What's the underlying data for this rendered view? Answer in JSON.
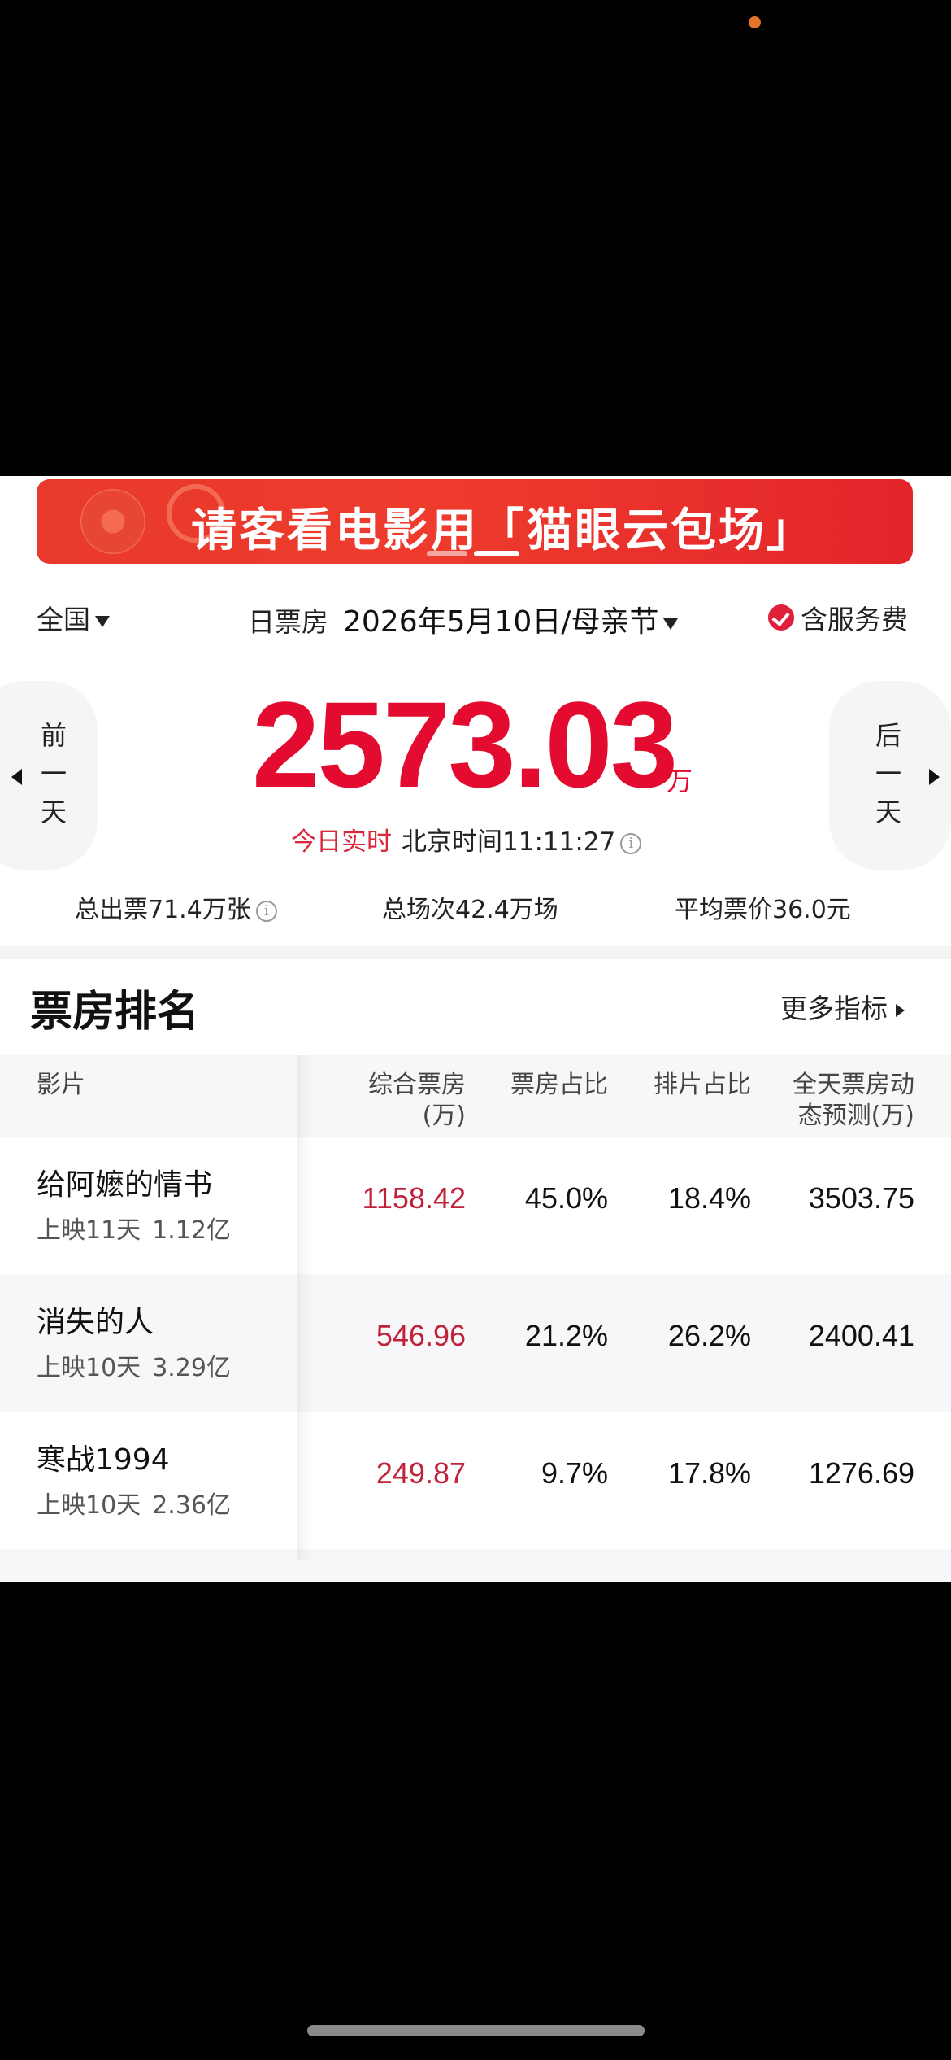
{
  "banner": {
    "text": "请客看电影用「猫眼云包场」"
  },
  "filter": {
    "region": "全国",
    "day_label": "日票房",
    "date": "2026年5月10日/母亲节",
    "service_fee": "含服务费"
  },
  "summary": {
    "prev_day": [
      "前",
      "一",
      "天"
    ],
    "next_day": [
      "后",
      "一",
      "天"
    ],
    "box_office": "2573.03",
    "unit": "万",
    "realtime_tag": "今日实时",
    "clock": "北京时间11:11:27",
    "tickets": "总出票71.4万张",
    "shows": "总场次42.4万场",
    "avg_price": "平均票价36.0元"
  },
  "ranking": {
    "title": "票房排名",
    "more": "更多指标",
    "headers": {
      "film": "影片",
      "box": [
        "综合票房",
        "(万)"
      ],
      "share": "票房占比",
      "schedule": "排片占比",
      "forecast": [
        "全天票房动",
        "态预测(万)"
      ]
    },
    "rows": [
      {
        "name": "给阿嬷的情书",
        "days": "上映11天",
        "total": "1.12亿",
        "box": "1158.42",
        "share": "45.0%",
        "schedule": "18.4%",
        "forecast": "3503.75"
      },
      {
        "name": "消失的人",
        "days": "上映10天",
        "total": "3.29亿",
        "box": "546.96",
        "share": "21.2%",
        "schedule": "26.2%",
        "forecast": "2400.41"
      },
      {
        "name": "寒战1994",
        "days": "上映10天",
        "total": "2.36亿",
        "box": "249.87",
        "share": "9.7%",
        "schedule": "17.8%",
        "forecast": "1276.69"
      }
    ]
  },
  "colors": {
    "accent": "#e30b2f",
    "banner": "#e83a2c"
  }
}
